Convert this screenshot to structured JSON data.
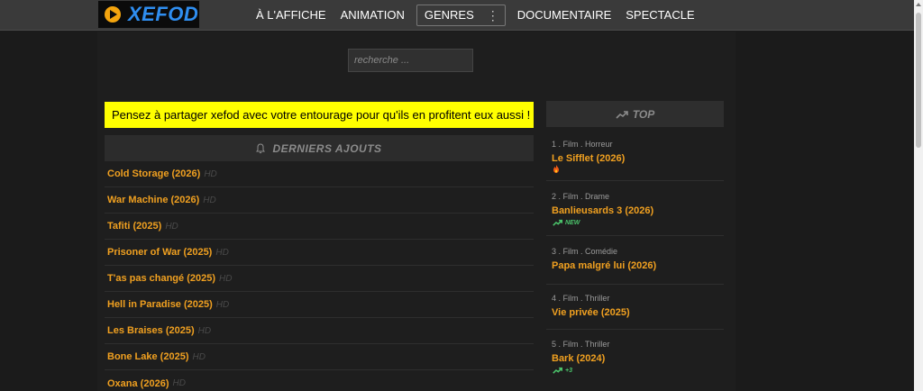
{
  "logo": {
    "text": "XEFOD"
  },
  "nav": {
    "items": [
      "À L'AFFICHE",
      "ANIMATION",
      "GENRES",
      "DOCUMENTAIRE",
      "SPECTACLE"
    ],
    "genres_more": "⋮"
  },
  "search": {
    "placeholder": "recherche ..."
  },
  "notice": {
    "text": "Pensez à partager xefod avec votre entourage pour qu'ils en profitent eux aussi !"
  },
  "latest": {
    "heading": "DERNIERS AJOUTS",
    "items": [
      {
        "title": "Cold Storage (2026)",
        "quality": "HD"
      },
      {
        "title": "War Machine (2026)",
        "quality": "HD"
      },
      {
        "title": "Tafiti (2025)",
        "quality": "HD"
      },
      {
        "title": "Prisoner of War (2025)",
        "quality": "HD"
      },
      {
        "title": "T'as pas changé (2025)",
        "quality": "HD"
      },
      {
        "title": "Hell in Paradise (2025)",
        "quality": "HD"
      },
      {
        "title": "Les Braises (2025)",
        "quality": "HD"
      },
      {
        "title": "Bone Lake (2025)",
        "quality": "HD"
      },
      {
        "title": "Oxana (2026)",
        "quality": "HD"
      }
    ]
  },
  "top": {
    "heading": "TOP",
    "items": [
      {
        "meta": "1 . Film . Horreur",
        "title": "Le Sifflet (2026)",
        "badge_icon": "flame-icon",
        "badge": ""
      },
      {
        "meta": "2 . Film . Drame",
        "title": "Banlieusards 3 (2026)",
        "badge_icon": "trend-up-icon",
        "badge": "NEW"
      },
      {
        "meta": "3 . Film . Comédie",
        "title": "Papa malgré lui (2026)",
        "badge_icon": "",
        "badge": ""
      },
      {
        "meta": "4 . Film . Thriller",
        "title": "Vie privée (2025)",
        "badge_icon": "",
        "badge": ""
      },
      {
        "meta": "5 . Film . Thriller",
        "title": "Bark (2024)",
        "badge_icon": "trend-up-icon",
        "badge": "+3"
      }
    ]
  },
  "colors": {
    "accent": "#f0a020",
    "notice_bg": "#ffff00",
    "logo_blue": "#2f8ef0",
    "trend_green": "#4bc46b"
  }
}
